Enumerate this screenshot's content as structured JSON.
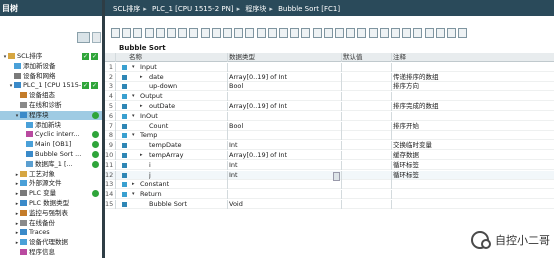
{
  "left_panel": {
    "title": "目树",
    "items": [
      {
        "label": "SCL排序",
        "level": 0,
        "arrow": "▾",
        "status": "check-green"
      },
      {
        "label": "添加新设备",
        "level": 1,
        "arrow": "",
        "status": ""
      },
      {
        "label": "设备和网络",
        "level": 1,
        "arrow": "",
        "status": ""
      },
      {
        "label": "PLC_1 [CPU 1515-...",
        "level": 1,
        "arrow": "▾",
        "status": "check-green"
      },
      {
        "label": "设备组态",
        "level": 2,
        "arrow": "",
        "status": ""
      },
      {
        "label": "在线和诊断",
        "level": 2,
        "arrow": "",
        "status": ""
      },
      {
        "label": "程序块",
        "level": 2,
        "arrow": "▾",
        "status": "dot-green",
        "selected": true
      },
      {
        "label": "添加新块",
        "level": 3,
        "arrow": "",
        "status": ""
      },
      {
        "label": "Cyclic interr...",
        "level": 3,
        "arrow": "",
        "status": "dot-green"
      },
      {
        "label": "Main [OB1]",
        "level": 3,
        "arrow": "",
        "status": "dot-green"
      },
      {
        "label": "Bubble Sort ...",
        "level": 3,
        "arrow": "",
        "status": "dot-green"
      },
      {
        "label": "数据库_1 [...",
        "level": 3,
        "arrow": "",
        "status": "dot-green"
      },
      {
        "label": "工艺对象",
        "level": 2,
        "arrow": "▸",
        "status": ""
      },
      {
        "label": "外部源文件",
        "level": 2,
        "arrow": "▸",
        "status": ""
      },
      {
        "label": "PLC 变量",
        "level": 2,
        "arrow": "▸",
        "status": "dot-green"
      },
      {
        "label": "PLC 数据类型",
        "level": 2,
        "arrow": "▸",
        "status": ""
      },
      {
        "label": "监控与强制表",
        "level": 2,
        "arrow": "▸",
        "status": ""
      },
      {
        "label": "在线备份",
        "level": 2,
        "arrow": "▸",
        "status": ""
      },
      {
        "label": "Traces",
        "level": 2,
        "arrow": "▸",
        "status": ""
      },
      {
        "label": "设备代理数据",
        "level": 2,
        "arrow": "▸",
        "status": ""
      },
      {
        "label": "程序信息",
        "level": 2,
        "arrow": "",
        "status": ""
      }
    ]
  },
  "breadcrumb": {
    "parts": [
      "SCL排序",
      "PLC_1 [CPU 1515-2 PN]",
      "程序块",
      "Bubble Sort [FC1]"
    ]
  },
  "block_title": "Bubble Sort",
  "table": {
    "columns": {
      "name": "名称",
      "type": "数据类型",
      "default": "默认值",
      "comment": "注释"
    },
    "rows": [
      {
        "num": "1",
        "level": 0,
        "toggle": "▾",
        "name": "Input",
        "type": "",
        "default": "",
        "comment": ""
      },
      {
        "num": "2",
        "level": 1,
        "toggle": "▸",
        "name": "date",
        "type": "Array[0..19] of Int",
        "default": "",
        "comment": "传递排序的数组"
      },
      {
        "num": "3",
        "level": 1,
        "toggle": "",
        "name": "up-down",
        "type": "Bool",
        "default": "",
        "comment": "排序方向"
      },
      {
        "num": "4",
        "level": 0,
        "toggle": "▾",
        "name": "Output",
        "type": "",
        "default": "",
        "comment": ""
      },
      {
        "num": "5",
        "level": 1,
        "toggle": "▸",
        "name": "outDate",
        "type": "Array[0..19] of Int",
        "default": "",
        "comment": "排序完成的数组"
      },
      {
        "num": "6",
        "level": 0,
        "toggle": "▾",
        "name": "InOut",
        "type": "",
        "default": "",
        "comment": ""
      },
      {
        "num": "7",
        "level": 1,
        "toggle": "",
        "name": "Count",
        "type": "Bool",
        "default": "",
        "comment": "排序开始"
      },
      {
        "num": "8",
        "level": 0,
        "toggle": "▾",
        "name": "Temp",
        "type": "",
        "default": "",
        "comment": ""
      },
      {
        "num": "9",
        "level": 1,
        "toggle": "",
        "name": "tempDate",
        "type": "Int",
        "default": "",
        "comment": "交换临时变量"
      },
      {
        "num": "10",
        "level": 1,
        "toggle": "▸",
        "name": "tempArray",
        "type": "Array[0..19] of Int",
        "default": "",
        "comment": "缓存数据"
      },
      {
        "num": "11",
        "level": 1,
        "toggle": "",
        "name": "i",
        "type": "Int",
        "default": "",
        "comment": "循环标签"
      },
      {
        "num": "12",
        "level": 1,
        "toggle": "",
        "name": "j",
        "type": "Int",
        "default": "",
        "comment": "循环标签"
      },
      {
        "num": "13",
        "level": 0,
        "toggle": "▸",
        "name": "Constant",
        "type": "",
        "default": "",
        "comment": ""
      },
      {
        "num": "14",
        "level": 0,
        "toggle": "▾",
        "name": "Return",
        "type": "",
        "default": "",
        "comment": ""
      },
      {
        "num": "15",
        "level": 1,
        "toggle": "",
        "name": "Bubble Sort",
        "type": "Void",
        "default": "",
        "comment": ""
      }
    ]
  },
  "watermark": {
    "text": "自控小二哥"
  },
  "colors": {
    "titlebar": "#2a4a5a",
    "selected": "#9fcbe3",
    "ok_green": "#2fa53a",
    "member_icon": "#2f86b5"
  }
}
